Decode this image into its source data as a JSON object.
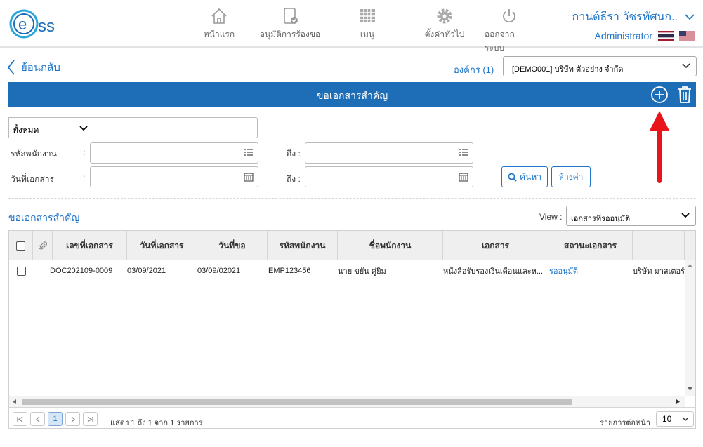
{
  "header": {
    "logo_text": "ss",
    "nav": [
      {
        "label": "หน้าแรก",
        "icon": "home-icon"
      },
      {
        "label": "อนุมัติการร้องขอ",
        "icon": "approve-document-icon"
      },
      {
        "label": "เมนู",
        "icon": "menu-grid-icon"
      },
      {
        "label": "ตั้งค่าทั่วไป",
        "icon": "gear-icon"
      },
      {
        "label": "ออกจากระบบ",
        "icon": "power-icon"
      }
    ],
    "user_name": "กานต์ธีรา วัชรทัศนก..",
    "user_role": "Administrator"
  },
  "back_label": "ย้อนกลับ",
  "org": {
    "label": "องค์กร (1)",
    "selected": "[DEMO001] บริษัท ตัวอย่าง จำกัด"
  },
  "page_title": "ขอเอกสารสำคัญ",
  "filters": {
    "scope": "ทั้งหมด",
    "employee_code_label": "รหัสพนักงาน",
    "doc_date_label": "วันที่เอกสาร",
    "colon": ":",
    "to_label": "ถึง :",
    "search_label": "ค้นหา",
    "clear_label": "ล้างค่า"
  },
  "list": {
    "title": "ขอเอกสารสำคัญ",
    "view_label": "View :",
    "view_selected": "เอกสารที่รออนุมัติ",
    "columns": [
      "เลขที่เอกสาร",
      "วันที่เอกสาร",
      "วันที่ขอ",
      "รหัสพนักงาน",
      "ชื่อพนักงาน",
      "เอกสาร",
      "สถานะเอกสาร"
    ],
    "rows": [
      {
        "doc_no": "DOC202109-0009",
        "doc_date": "03/09/2021",
        "request_date": "03/09/02021",
        "emp_code": "EMP123456",
        "emp_name": "นาย ขยัน คู่ยิม",
        "document": "หนังสือรับรองเงินเดือนและห...",
        "status": "รออนุมัติ",
        "company": "บริษัท มาสเตอร์"
      }
    ]
  },
  "pager": {
    "current_page": "1",
    "info": "แสดง 1 ถึง 1 จาก 1 รายการ",
    "page_size_label": "รายการต่อหน้า",
    "page_size": "10"
  },
  "colors": {
    "primary": "#1e6db7",
    "link": "#1e75c8",
    "annotation": "#e8141a"
  }
}
